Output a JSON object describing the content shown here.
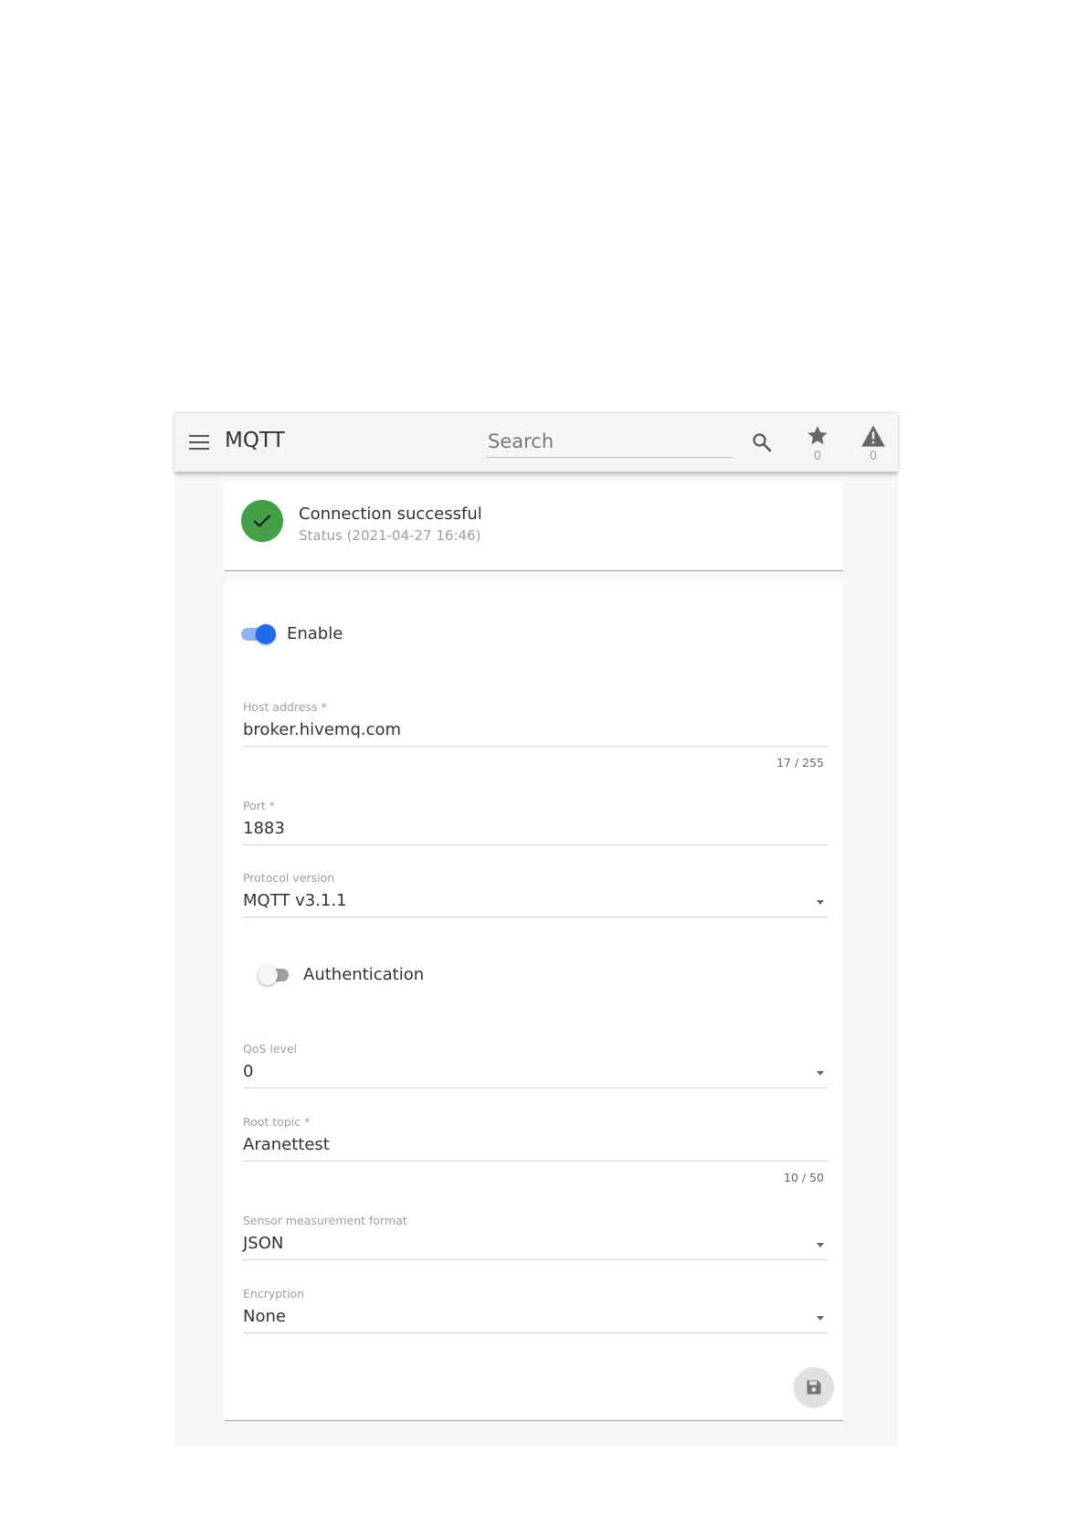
{
  "header": {
    "title": "MQTT",
    "search_placeholder": "Search",
    "favorites_count": "0",
    "alerts_count": "0"
  },
  "status": {
    "title": "Connection successful",
    "subtitle": "Status (2021-04-27 16:46)"
  },
  "form": {
    "enable_label": "Enable",
    "enable_on": true,
    "host": {
      "label": "Host address *",
      "value": "broker.hivemq.com",
      "counter": "17 / 255"
    },
    "port": {
      "label": "Port *",
      "value": "1883"
    },
    "protocol": {
      "label": "Protocol version",
      "value": "MQTT v3.1.1"
    },
    "auth_label": "Authentication",
    "auth_on": false,
    "qos": {
      "label": "QoS level",
      "value": "0"
    },
    "root_topic": {
      "label": "Root topic *",
      "value": "Aranettest",
      "counter": "10 / 50"
    },
    "format": {
      "label": "Sensor measurement format",
      "value": "JSON"
    },
    "encryption": {
      "label": "Encryption",
      "value": "None"
    }
  },
  "colors": {
    "accent": "#1e6bf0",
    "success": "#43a047"
  },
  "icons": {
    "menu": "hamburger-menu-icon",
    "search": "magnifier-icon",
    "favorites": "star-icon",
    "alerts": "warning-triangle-icon",
    "status": "check-icon",
    "save": "floppy-disk-icon"
  }
}
